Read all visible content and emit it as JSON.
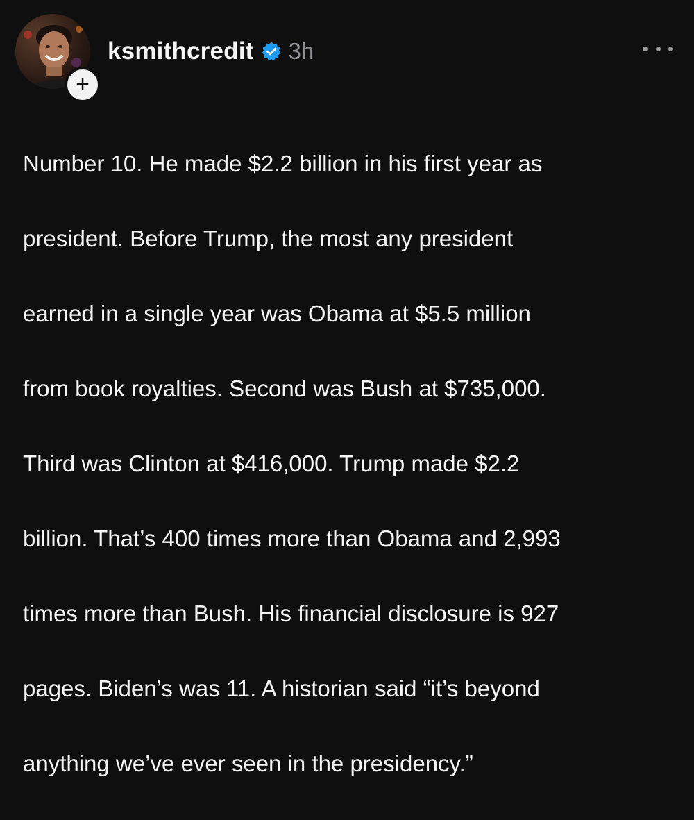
{
  "post": {
    "author": {
      "username": "ksmithcredit",
      "verified": true,
      "verified_icon": "verified-badge-icon",
      "follow_label": "+"
    },
    "timestamp": "3h",
    "more_icon": "more-horizontal-icon",
    "text_lines": [
      "Number 10. He made $2.2 billion in his first year as",
      "president. Before Trump, the most any president",
      "earned in a single year was Obama at $5.5 million",
      "from book royalties. Second was Bush at $735,000.",
      "Third was Clinton at $416,000. Trump made $2.2",
      "billion. That’s 400 times more than Obama and 2,993",
      "times more than Bush. His financial disclosure is 927",
      "pages. Biden’s was 11. A historian said “it’s beyond",
      "anything we’ve ever seen in the presidency.”"
    ]
  },
  "colors": {
    "background": "#0f0f10",
    "text": "#f5f5f5",
    "muted": "#8e8e93",
    "verified_blue": "#1d9bf0"
  }
}
